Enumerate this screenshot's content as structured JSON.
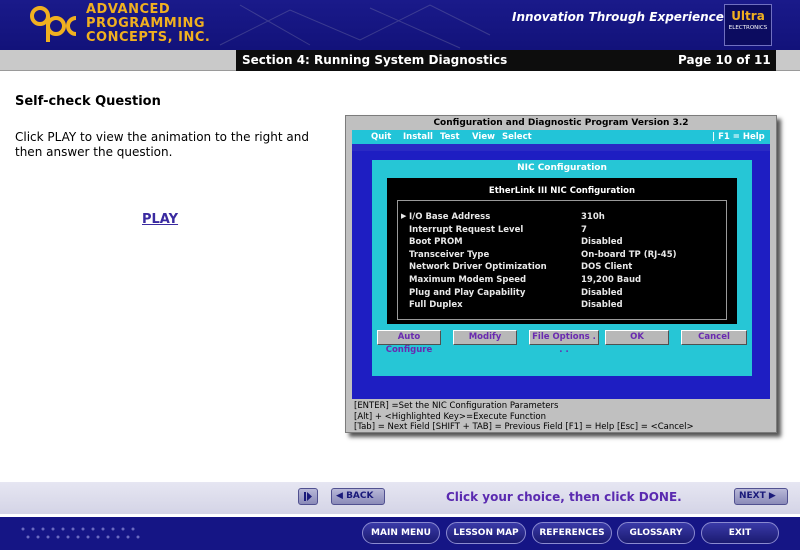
{
  "header": {
    "company_lines": [
      "ADVANCED",
      "PROGRAMMING",
      "CONCEPTS, INC."
    ],
    "tagline": "Innovation Through Experience",
    "ultra_name": "Ultra",
    "ultra_sub": "ELECTRONICS"
  },
  "section": {
    "title": "Section 4: Running System Diagnostics",
    "page": "Page 10 of 11"
  },
  "content": {
    "question_title": "Self-check Question",
    "instructions": "Click PLAY to view the animation to the right and then answer the question.",
    "play_label": "PLAY"
  },
  "sim": {
    "window_title": "Configuration and Diagnostic Program   Version 3.2",
    "menu": [
      "Quit",
      "Install",
      "Test",
      "View",
      "Select"
    ],
    "help": "|  F1 = Help",
    "panel_title": "NIC Configuration",
    "box_title": "EtherLink III NIC Configuration",
    "rows": [
      {
        "label": "I/O Base Address",
        "value": "310h"
      },
      {
        "label": "Interrupt Request Level",
        "value": "7"
      },
      {
        "label": "Boot PROM",
        "value": "Disabled"
      },
      {
        "label": "Transceiver Type",
        "value": "On-board TP (RJ-45)"
      },
      {
        "label": "Network Driver Optimization",
        "value": "DOS Client"
      },
      {
        "label": "Maximum Modem Speed",
        "value": "19,200 Baud"
      },
      {
        "label": "Plug and Play Capability",
        "value": "Disabled"
      },
      {
        "label": "Full Duplex",
        "value": "Disabled"
      }
    ],
    "buttons": [
      "Auto Configure",
      "Modify",
      "File Options . . .",
      "OK",
      "Cancel"
    ],
    "status": [
      "[ENTER] =Set the NIC Configuration Parameters",
      "[Alt] + <Highlighted  Key>=Execute Function",
      "[Tab] = Next Field    [SHIFT + TAB] = Previous Field    [F1] = Help    [Esc] = <Cancel>"
    ]
  },
  "nav": {
    "back": "BACK",
    "prompt": "Click your choice, then click DONE.",
    "next": "NEXT"
  },
  "footer": {
    "buttons": [
      "MAIN MENU",
      "LESSON MAP",
      "REFERENCES",
      "GLOSSARY",
      "EXIT"
    ]
  },
  "colors": {
    "header_bg": "#1a1a8a",
    "logo_gold": "#f0b020",
    "sim_cyan": "#26c6d6",
    "sim_blue": "#1e1ec2",
    "prompt_purple": "#5a2ab0"
  }
}
